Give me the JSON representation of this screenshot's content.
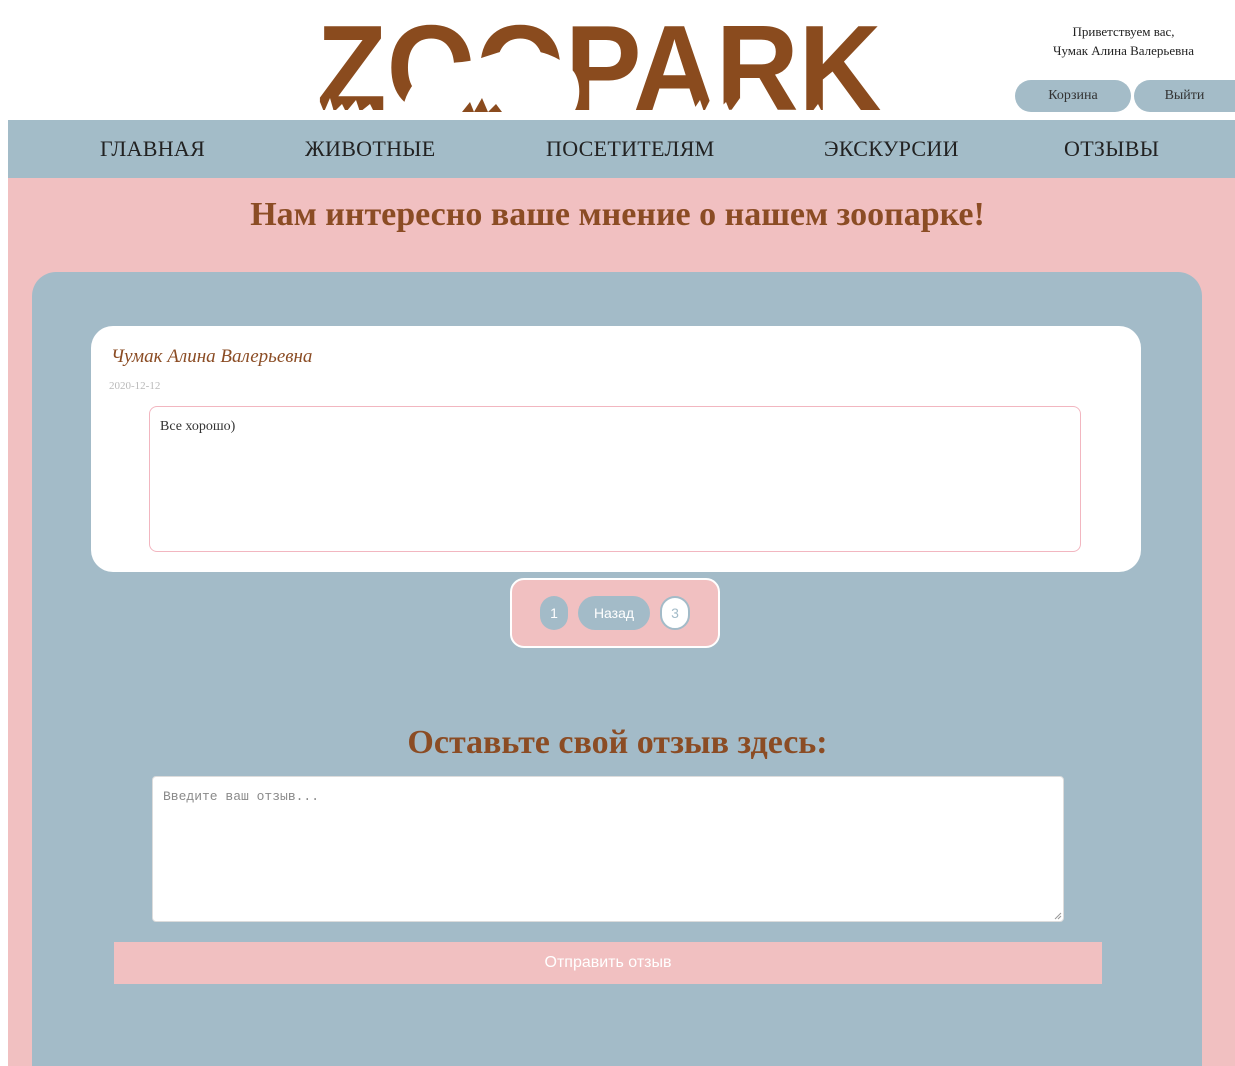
{
  "header": {
    "logo_text": "ZOOPARK",
    "greeting_line1": "Приветствуем вас,",
    "greeting_line2": "Чумак Алина Валерьевна",
    "cart_label": "Корзина",
    "logout_label": "Выйти"
  },
  "nav": {
    "items": [
      {
        "label": "ГЛАВНАЯ"
      },
      {
        "label": "ЖИВОТНЫЕ"
      },
      {
        "label": "ПОСЕТИТЕЛЯМ"
      },
      {
        "label": "ЭКСКУРСИИ"
      },
      {
        "label": "ОТЗЫВЫ"
      }
    ]
  },
  "main": {
    "title": "Нам интересно ваше мнение о нашем зоопарке!",
    "review": {
      "author": "Чумак Алина Валерьевна",
      "date": "2020-12-12",
      "text": "Все хорошо)"
    },
    "pagination": {
      "page_first": "1",
      "back_label": "Назад",
      "page_current": "3"
    },
    "form": {
      "title": "Оставьте свой отзыв здесь:",
      "placeholder": "Введите ваш отзыв...",
      "value": "",
      "submit_label": "Отправить отзыв"
    }
  },
  "colors": {
    "nav_bg": "#a3bcc8",
    "page_pink": "#f1c0c1",
    "brand_brown": "#8b4c24"
  },
  "icons": {
    "logo_art": "zoopark-logo-silhouette",
    "resize": "resize-grip-icon"
  }
}
